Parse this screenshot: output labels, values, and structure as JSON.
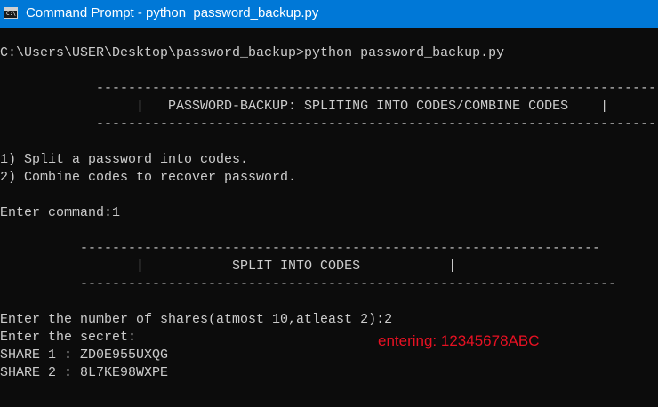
{
  "window": {
    "title": "Command Prompt - python  password_backup.py",
    "icon": "cmd-icon",
    "icon_text": "C:\\"
  },
  "console": {
    "lines": [
      "C:\\Users\\USER\\Desktop\\password_backup>python password_backup.py",
      "            ------------------------------------------------------------------------------",
      "                 |   PASSWORD-BACKUP: SPLITING INTO CODES/COMBINE CODES    |",
      "            ------------------------------------------------------------------------------",
      "1) Split a password into codes.",
      "2) Combine codes to recover password.",
      "Enter command:1",
      "          -----------------------------------------------------------------",
      "                 |           SPLIT INTO CODES           |",
      "          -------------------------------------------------------------------",
      "Enter the number of shares(atmost 10,atleast 2):2",
      "Enter the secret:",
      "SHARE 1 : ZD0E955UXQG",
      "SHARE 2 : 8L7KE98WXPE"
    ]
  },
  "annotation": {
    "text": "entering: 12345678ABC",
    "color": "#e81123"
  },
  "colors": {
    "titlebar": "#0078d7",
    "console_bg": "#0c0c0c",
    "console_text": "#cccccc"
  }
}
